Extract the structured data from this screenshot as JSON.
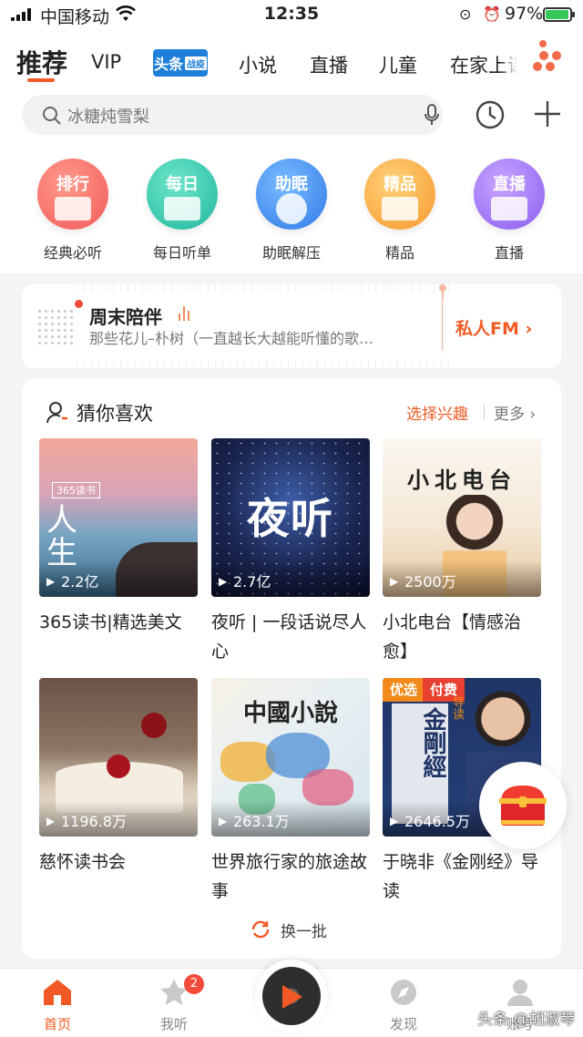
{
  "status_bar": {
    "carrier": "中国移动",
    "time": "12:35",
    "battery_percent": "97%",
    "battery_level": 0.97,
    "icons": [
      "signal-icon",
      "wifi-icon",
      "orientation-lock-icon",
      "alarm-icon",
      "battery-charging-icon"
    ]
  },
  "top_tabs": {
    "active": "推荐",
    "items": [
      "VIP",
      "小说",
      "直播",
      "儿童",
      "在家上课"
    ],
    "badge_logo": "头条",
    "badge_logo_sub": "战疫"
  },
  "search": {
    "placeholder": "冰糖炖雪梨",
    "icons": [
      "search-icon",
      "microphone-icon",
      "history-icon",
      "add-icon"
    ]
  },
  "categories": [
    {
      "badge": "排行",
      "label": "经典必听",
      "color": "#f25a5a"
    },
    {
      "badge": "每日",
      "label": "每日听单",
      "color": "#2fc7a3"
    },
    {
      "badge": "助眠",
      "label": "助眠解压",
      "color": "#3b8ef2"
    },
    {
      "badge": "精品",
      "label": "精品",
      "color": "#f9a33a"
    },
    {
      "badge": "直播",
      "label": "直播",
      "color": "#9b6cf5"
    }
  ],
  "fm_card": {
    "title": "周末陪伴",
    "subtitle": "那些花儿–朴树（一直越长大越能听懂的歌…",
    "button": "私人FM ›"
  },
  "recommend": {
    "title": "猜你喜欢",
    "pick_interest": "选择兴趣",
    "more": "更多 ›",
    "items": [
      {
        "cover_text": "人生",
        "cover_badge": "365读书",
        "plays": "2.2亿",
        "title": "365读书|精选美文"
      },
      {
        "cover_text": "夜听",
        "plays": "2.7亿",
        "title": "夜听 | 一段话说尽人心"
      },
      {
        "cover_text": "小北电台",
        "plays": "2500万",
        "title": "小北电台【情感治愈】"
      },
      {
        "plays": "1196.8万",
        "title": "慈怀读书会"
      },
      {
        "cover_text": "中國小說",
        "plays": "263.1万",
        "title": "世界旅行家的旅途故事"
      },
      {
        "cover_text": "金剛經",
        "tag1": "优选",
        "tag2": "付费",
        "side_text": "导读",
        "plays": "2646.5万",
        "title": "于晓非《金刚经》导读"
      }
    ],
    "refresh": "换一批"
  },
  "bottom_nav": {
    "items": [
      "首页",
      "我听",
      "发现",
      "账号"
    ],
    "badge_count": "2",
    "active": "首页"
  },
  "watermark": "头条 @胡淑琴",
  "colors": {
    "accent": "#f15a24",
    "background": "#f4f4f6"
  }
}
